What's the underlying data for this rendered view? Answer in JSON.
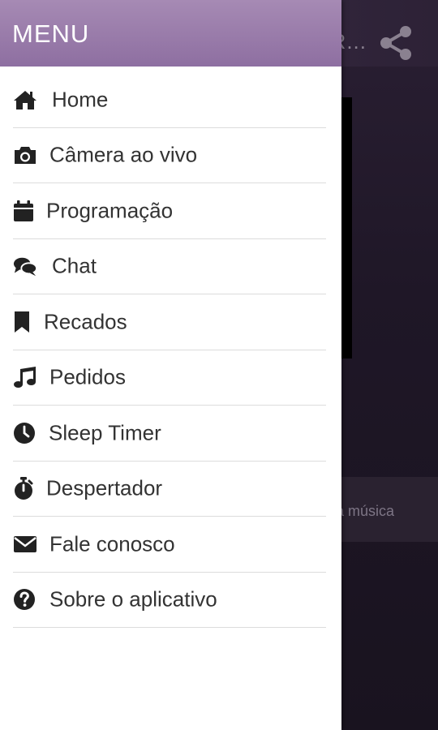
{
  "drawer": {
    "title": "MENU",
    "items": [
      {
        "label": "Home",
        "icon": "home-icon"
      },
      {
        "label": "Câmera ao vivo",
        "icon": "camera-icon"
      },
      {
        "label": "Programação",
        "icon": "calendar-icon"
      },
      {
        "label": "Chat",
        "icon": "chat-icon"
      },
      {
        "label": "Recados",
        "icon": "bookmark-icon"
      },
      {
        "label": "Pedidos",
        "icon": "music-icon"
      },
      {
        "label": "Sleep Timer",
        "icon": "clock-icon"
      },
      {
        "label": "Despertador",
        "icon": "stopwatch-icon"
      },
      {
        "label": "Fale conosco",
        "icon": "envelope-icon"
      },
      {
        "label": "Sobre o aplicativo",
        "icon": "question-icon"
      }
    ]
  },
  "background_app": {
    "title_fragment": "R...",
    "now_playing_fragment": "a música"
  },
  "colors": {
    "header_accent": "#9b7cab",
    "icon": "#222222",
    "text": "#333333"
  }
}
